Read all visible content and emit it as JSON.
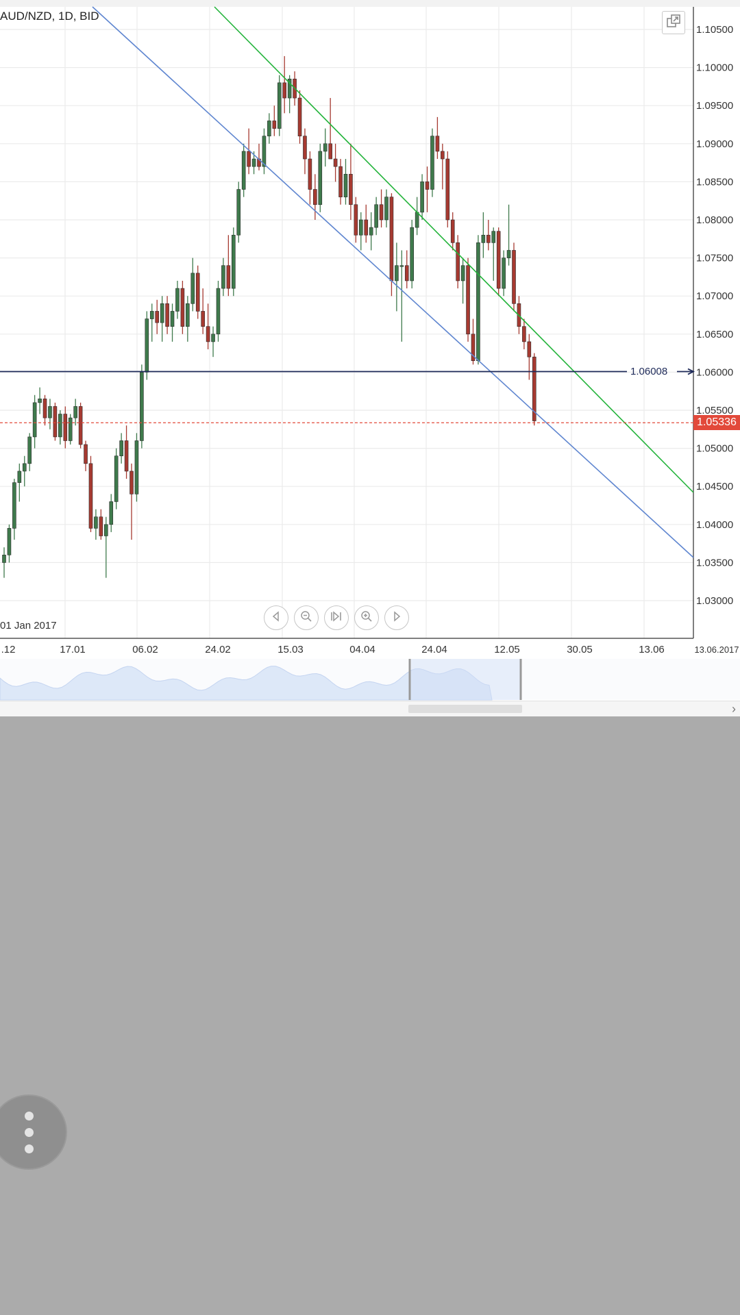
{
  "chart_title": "AUD/NZD, 1D, BID",
  "start_date_label": "01 Jan 2017",
  "colors": {
    "bullish": "#3f7a4c",
    "bearish": "#a63a31",
    "trend_line_green": "#22b33a",
    "trend_line_blue": "#5f86d0",
    "horizontal_line": "#1f2b5a",
    "current_price_line": "#e2493a",
    "grid": "#ebebeb",
    "navigator_fill": "#dde8f8"
  },
  "icons": {
    "popout": "popout-icon",
    "nav": [
      "arrow-left-icon",
      "zoom-out-icon",
      "reset-view-icon",
      "zoom-in-icon",
      "arrow-right-icon"
    ],
    "menu": "more-vertical-icon",
    "scroll_right": "chevron-right-icon"
  },
  "chart_data": {
    "type": "candlestick",
    "title": "AUD/NZD, 1D, BID",
    "y_ticks": [
      "1.10500",
      "1.10000",
      "1.09500",
      "1.09000",
      "1.08500",
      "1.08000",
      "1.07500",
      "1.07000",
      "1.06500",
      "1.06000",
      "1.05500",
      "1.05000",
      "1.04500",
      "1.04000",
      "1.03500",
      "1.03000"
    ],
    "x_ticks": [
      ".12",
      "17.01",
      "06.02",
      "24.02",
      "15.03",
      "04.04",
      "24.04",
      "12.05",
      "30.05",
      "13.06",
      "13.06.2017"
    ],
    "horizontal_line": {
      "value": 1.06008,
      "label": "1.06008"
    },
    "current_price": {
      "value": 1.05336,
      "label": "1.05336"
    },
    "trend_lines": [
      {
        "name": "",
        "color": "green",
        "from": {
          "x": "03.03",
          "y": 1.1135
        },
        "to": {
          "x": "02.06",
          "y": 1.0445
        }
      },
      {
        "name": "",
        "color": "blue",
        "from": {
          "x": "10.01",
          "y": 1.1135
        },
        "to": {
          "x": "02.06",
          "y": 1.0355
        }
      }
    ],
    "candles": [
      [
        1.035,
        1.037,
        1.033,
        1.036
      ],
      [
        1.036,
        1.04,
        1.035,
        1.0395
      ],
      [
        1.0395,
        1.046,
        1.038,
        1.0455
      ],
      [
        1.0455,
        1.048,
        1.043,
        1.047
      ],
      [
        1.047,
        1.049,
        1.045,
        1.048
      ],
      [
        1.048,
        1.052,
        1.047,
        1.0515
      ],
      [
        1.0515,
        1.057,
        1.05,
        1.056
      ],
      [
        1.056,
        1.058,
        1.0545,
        1.0565
      ],
      [
        1.0565,
        1.057,
        1.053,
        1.054
      ],
      [
        1.054,
        1.0565,
        1.0525,
        1.0555
      ],
      [
        1.0555,
        1.056,
        1.051,
        1.0515
      ],
      [
        1.0515,
        1.055,
        1.0505,
        1.0545
      ],
      [
        1.0545,
        1.0555,
        1.05,
        1.051
      ],
      [
        1.051,
        1.0545,
        1.0505,
        1.054
      ],
      [
        1.054,
        1.0565,
        1.053,
        1.0555
      ],
      [
        1.0555,
        1.056,
        1.05,
        1.0505
      ],
      [
        1.0505,
        1.051,
        1.047,
        1.048
      ],
      [
        1.048,
        1.049,
        1.039,
        1.0395
      ],
      [
        1.0395,
        1.042,
        1.038,
        1.041
      ],
      [
        1.041,
        1.042,
        1.038,
        1.0385
      ],
      [
        1.0385,
        1.041,
        1.033,
        1.04
      ],
      [
        1.04,
        1.044,
        1.039,
        1.043
      ],
      [
        1.043,
        1.05,
        1.042,
        1.049
      ],
      [
        1.049,
        1.052,
        1.048,
        1.051
      ],
      [
        1.051,
        1.053,
        1.046,
        1.047
      ],
      [
        1.047,
        1.048,
        1.038,
        1.044
      ],
      [
        1.044,
        1.052,
        1.043,
        1.051
      ],
      [
        1.051,
        1.061,
        1.05,
        1.06
      ],
      [
        1.06,
        1.068,
        1.059,
        1.067
      ],
      [
        1.067,
        1.069,
        1.064,
        1.068
      ],
      [
        1.068,
        1.0695,
        1.065,
        1.0665
      ],
      [
        1.0665,
        1.07,
        1.064,
        1.069
      ],
      [
        1.069,
        1.07,
        1.065,
        1.066
      ],
      [
        1.066,
        1.069,
        1.064,
        1.068
      ],
      [
        1.068,
        1.072,
        1.067,
        1.071
      ],
      [
        1.071,
        1.072,
        1.065,
        1.066
      ],
      [
        1.066,
        1.07,
        1.064,
        1.069
      ],
      [
        1.069,
        1.075,
        1.068,
        1.073
      ],
      [
        1.073,
        1.074,
        1.067,
        1.068
      ],
      [
        1.068,
        1.071,
        1.065,
        1.066
      ],
      [
        1.066,
        1.069,
        1.063,
        1.064
      ],
      [
        1.064,
        1.066,
        1.062,
        1.065
      ],
      [
        1.065,
        1.072,
        1.064,
        1.071
      ],
      [
        1.071,
        1.075,
        1.07,
        1.074
      ],
      [
        1.074,
        1.078,
        1.07,
        1.071
      ],
      [
        1.071,
        1.079,
        1.07,
        1.078
      ],
      [
        1.078,
        1.085,
        1.077,
        1.084
      ],
      [
        1.084,
        1.09,
        1.083,
        1.089
      ],
      [
        1.089,
        1.092,
        1.086,
        1.087
      ],
      [
        1.087,
        1.089,
        1.086,
        1.088
      ],
      [
        1.088,
        1.09,
        1.0865,
        1.087
      ],
      [
        1.087,
        1.092,
        1.086,
        1.091
      ],
      [
        1.091,
        1.094,
        1.09,
        1.093
      ],
      [
        1.093,
        1.095,
        1.091,
        1.092
      ],
      [
        1.092,
        1.099,
        1.091,
        1.098
      ],
      [
        1.098,
        1.1015,
        1.094,
        1.096
      ],
      [
        1.096,
        1.099,
        1.094,
        1.0985
      ],
      [
        1.0985,
        1.0995,
        1.095,
        1.096
      ],
      [
        1.096,
        1.097,
        1.09,
        1.091
      ],
      [
        1.091,
        1.092,
        1.086,
        1.088
      ],
      [
        1.088,
        1.089,
        1.082,
        1.084
      ],
      [
        1.084,
        1.086,
        1.08,
        1.082
      ],
      [
        1.082,
        1.09,
        1.081,
        1.089
      ],
      [
        1.089,
        1.092,
        1.087,
        1.09
      ],
      [
        1.09,
        1.096,
        1.088,
        1.088
      ],
      [
        1.088,
        1.09,
        1.085,
        1.087
      ],
      [
        1.087,
        1.088,
        1.082,
        1.083
      ],
      [
        1.083,
        1.088,
        1.082,
        1.086
      ],
      [
        1.086,
        1.09,
        1.08,
        1.082
      ],
      [
        1.082,
        1.083,
        1.077,
        1.078
      ],
      [
        1.078,
        1.081,
        1.076,
        1.08
      ],
      [
        1.08,
        1.082,
        1.077,
        1.078
      ],
      [
        1.078,
        1.081,
        1.076,
        1.079
      ],
      [
        1.079,
        1.083,
        1.078,
        1.082
      ],
      [
        1.082,
        1.084,
        1.079,
        1.08
      ],
      [
        1.08,
        1.084,
        1.079,
        1.083
      ],
      [
        1.083,
        1.0835,
        1.07,
        1.072
      ],
      [
        1.072,
        1.077,
        1.068,
        1.074
      ],
      [
        1.074,
        1.076,
        1.064,
        1.074
      ],
      [
        1.074,
        1.076,
        1.071,
        1.072
      ],
      [
        1.072,
        1.08,
        1.071,
        1.079
      ],
      [
        1.079,
        1.083,
        1.078,
        1.081
      ],
      [
        1.081,
        1.086,
        1.08,
        1.085
      ],
      [
        1.085,
        1.087,
        1.081,
        1.084
      ],
      [
        1.084,
        1.092,
        1.083,
        1.091
      ],
      [
        1.091,
        1.0935,
        1.088,
        1.089
      ],
      [
        1.089,
        1.09,
        1.084,
        1.088
      ],
      [
        1.088,
        1.089,
        1.079,
        1.08
      ],
      [
        1.08,
        1.081,
        1.076,
        1.077
      ],
      [
        1.077,
        1.078,
        1.071,
        1.072
      ],
      [
        1.072,
        1.075,
        1.069,
        1.074
      ],
      [
        1.074,
        1.075,
        1.064,
        1.065
      ],
      [
        1.065,
        1.067,
        1.061,
        1.0615
      ],
      [
        1.0615,
        1.078,
        1.061,
        1.077
      ],
      [
        1.077,
        1.081,
        1.075,
        1.078
      ],
      [
        1.078,
        1.08,
        1.076,
        1.077
      ],
      [
        1.077,
        1.079,
        1.072,
        1.0785
      ],
      [
        1.0785,
        1.079,
        1.07,
        1.071
      ],
      [
        1.071,
        1.076,
        1.07,
        1.075
      ],
      [
        1.075,
        1.082,
        1.074,
        1.076
      ],
      [
        1.076,
        1.077,
        1.068,
        1.069
      ],
      [
        1.069,
        1.07,
        1.065,
        1.066
      ],
      [
        1.066,
        1.067,
        1.063,
        1.064
      ],
      [
        1.064,
        1.065,
        1.059,
        1.062
      ],
      [
        1.062,
        1.0625,
        1.053,
        1.0536
      ]
    ]
  }
}
